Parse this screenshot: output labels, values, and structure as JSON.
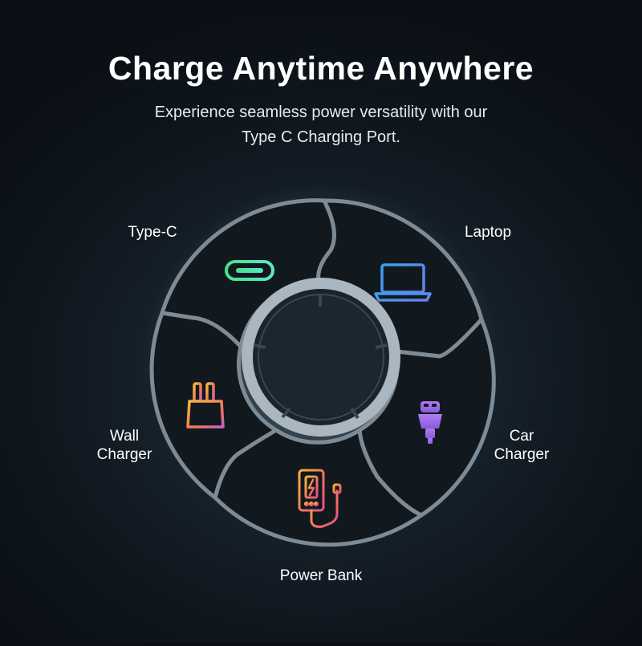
{
  "header": {
    "title": "Charge Anytime Anywhere",
    "subtitle_line1": "Experience seamless power versatility with our",
    "subtitle_line2": "Type C Charging Port."
  },
  "wheel": {
    "segments": [
      {
        "key": "type_c",
        "label_line1": "Type-C",
        "label_line2": "",
        "icon": "usb-c-port-icon"
      },
      {
        "key": "laptop",
        "label_line1": "Laptop",
        "label_line2": "",
        "icon": "laptop-icon"
      },
      {
        "key": "car_charger",
        "label_line1": "Car",
        "label_line2": "Charger",
        "icon": "car-charger-icon"
      },
      {
        "key": "power_bank",
        "label_line1": "Power Bank",
        "label_line2": "",
        "icon": "power-bank-icon"
      },
      {
        "key": "wall_charger",
        "label_line1": "Wall",
        "label_line2": "Charger",
        "icon": "wall-charger-icon"
      }
    ]
  },
  "colors": {
    "background": "#0f161e",
    "segment_fill": "#12191e",
    "divider": "#8a97a2",
    "ring": "#aab6c0"
  }
}
